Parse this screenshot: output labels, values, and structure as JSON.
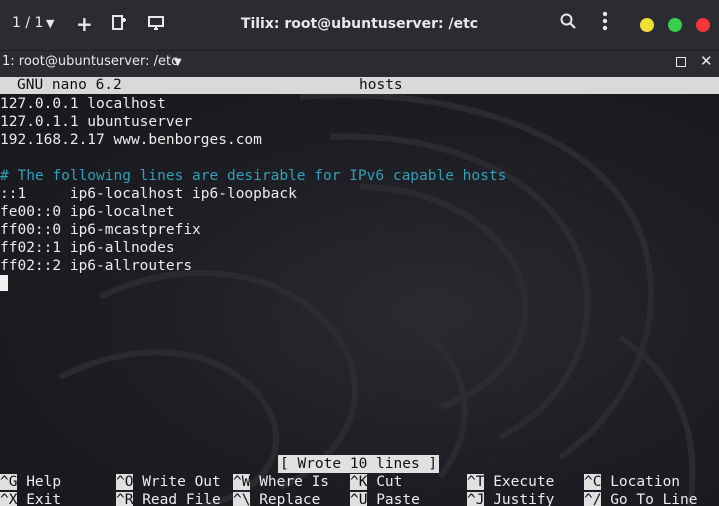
{
  "window": {
    "session_counter": "1 / 1",
    "title": "Tilix: root@ubuntuserver: /etc"
  },
  "tab": {
    "label": "1: root@ubuntuserver: /etc"
  },
  "nano": {
    "version": "GNU nano 6.2",
    "filename": "hosts",
    "lines": [
      {
        "text": "127.0.0.1 localhost",
        "comment": false
      },
      {
        "text": "127.0.1.1 ubuntuserver",
        "comment": false
      },
      {
        "text": "192.168.2.17 www.benborges.com",
        "comment": false
      },
      {
        "text": "",
        "comment": false
      },
      {
        "text": "# The following lines are desirable for IPv6 capable hosts",
        "comment": true
      },
      {
        "text": "::1     ip6-localhost ip6-loopback",
        "comment": false
      },
      {
        "text": "fe00::0 ip6-localnet",
        "comment": false
      },
      {
        "text": "ff00::0 ip6-mcastprefix",
        "comment": false
      },
      {
        "text": "ff02::1 ip6-allnodes",
        "comment": false
      },
      {
        "text": "ff02::2 ip6-allrouters",
        "comment": false
      }
    ],
    "status": "[ Wrote 10 lines ]",
    "shortcuts_row1": [
      {
        "key": "^G",
        "label": "Help"
      },
      {
        "key": "^O",
        "label": "Write Out"
      },
      {
        "key": "^W",
        "label": "Where Is"
      },
      {
        "key": "^K",
        "label": "Cut"
      },
      {
        "key": "^T",
        "label": "Execute"
      },
      {
        "key": "^C",
        "label": "Location"
      }
    ],
    "shortcuts_row2": [
      {
        "key": "^X",
        "label": "Exit"
      },
      {
        "key": "^R",
        "label": "Read File"
      },
      {
        "key": "^\\",
        "label": "Replace"
      },
      {
        "key": "^U",
        "label": "Paste"
      },
      {
        "key": "^J",
        "label": "Justify"
      },
      {
        "key": "^/",
        "label": "Go To Line"
      }
    ]
  },
  "colors": {
    "comment": "#2fa0b8",
    "close": "#f4363c",
    "maximize": "#39cf4c",
    "minimize": "#f0e034"
  },
  "icons": [
    "dropdown-caret-icon",
    "add-terminal-icon",
    "new-session-icon",
    "sync-input-icon",
    "search-icon",
    "menu-icon",
    "maximize-icon",
    "close-icon"
  ]
}
